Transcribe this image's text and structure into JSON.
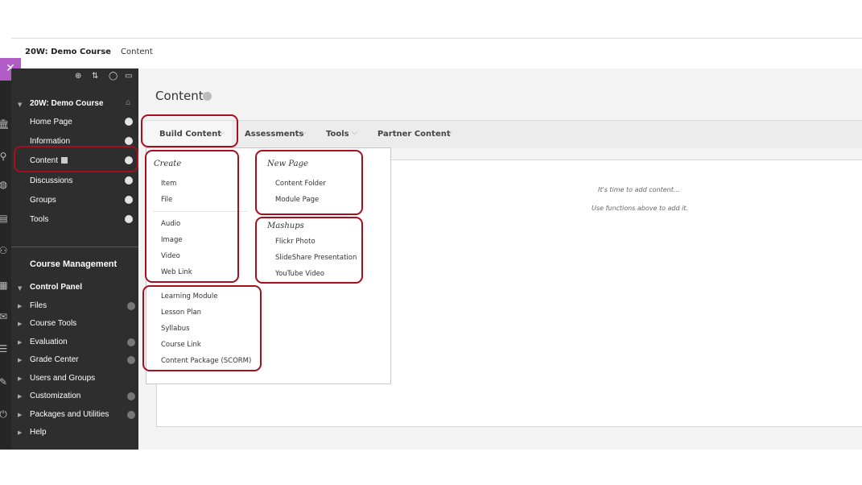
{
  "breadcrumb": {
    "course": "20W: Demo Course",
    "page": "Content"
  },
  "rail": {
    "close": "✕"
  },
  "menu": {
    "course_title": "20W: Demo Course",
    "items": [
      {
        "label": "Home Page"
      },
      {
        "label": "Information"
      },
      {
        "label": "Content"
      },
      {
        "label": "Discussions"
      },
      {
        "label": "Groups"
      },
      {
        "label": "Tools"
      }
    ],
    "course_management": "Course Management",
    "control_panel": "Control Panel",
    "cp_items": [
      {
        "label": "Files"
      },
      {
        "label": "Course Tools"
      },
      {
        "label": "Evaluation"
      },
      {
        "label": "Grade Center"
      },
      {
        "label": "Users and Groups"
      },
      {
        "label": "Customization"
      },
      {
        "label": "Packages and Utilities"
      },
      {
        "label": "Help"
      }
    ]
  },
  "main": {
    "title": "Content",
    "tabs": [
      {
        "label": "Build Content"
      },
      {
        "label": "Assessments"
      },
      {
        "label": "Tools"
      },
      {
        "label": "Partner Content"
      }
    ],
    "empty_line1": "It's time to add content...",
    "empty_line2": "Use functions above to add it."
  },
  "dropdown": {
    "create_heading": "Create",
    "create_items": [
      "Item",
      "File",
      "Audio",
      "Image",
      "Video",
      "Web Link"
    ],
    "more_items": [
      "Learning Module",
      "Lesson Plan",
      "Syllabus",
      "Course Link",
      "Content Package (SCORM)"
    ],
    "newpage_heading": "New Page",
    "newpage_items": [
      "Content Folder",
      "Module Page"
    ],
    "mashups_heading": "Mashups",
    "mashups_items": [
      "Flickr Photo",
      "SlideShare Presentation",
      "YouTube Video"
    ]
  },
  "colors": {
    "highlight": "#a50f1e",
    "menu_bg": "#2e2e2e",
    "accent_purple": "#b15bc7"
  }
}
